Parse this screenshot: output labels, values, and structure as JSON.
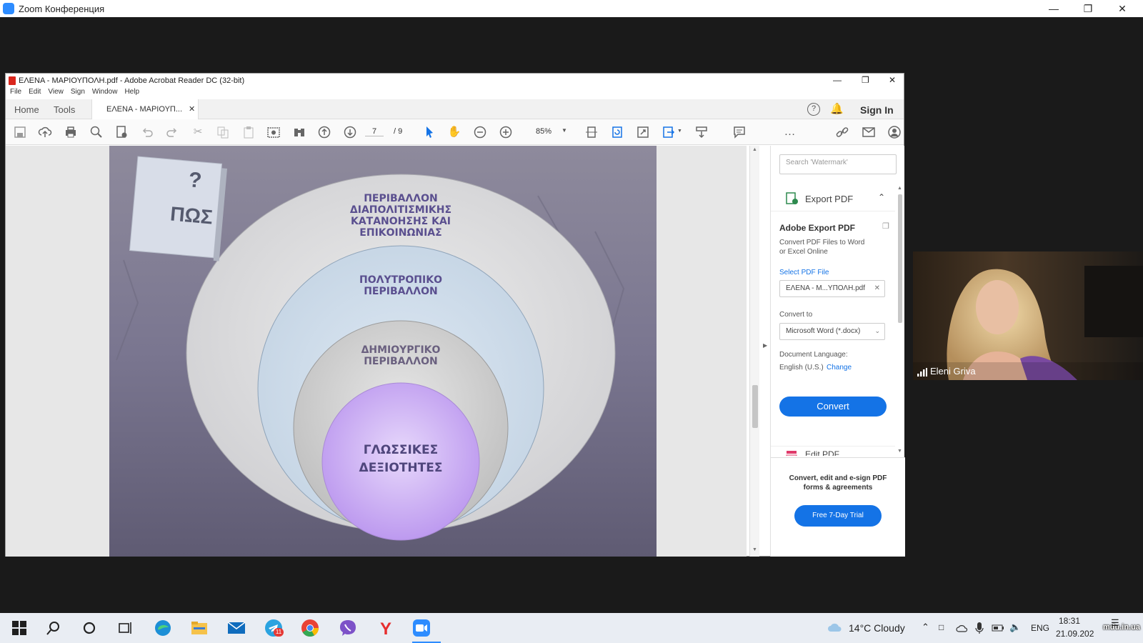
{
  "zoom_window": {
    "title": "Zoom Конференция"
  },
  "acrobat": {
    "title": "ΕΛΕΝΑ - ΜΑΡΙΟΥΠΟΛΗ.pdf - Adobe Acrobat Reader DC (32-bit)",
    "menu": [
      "File",
      "Edit",
      "View",
      "Sign",
      "Window",
      "Help"
    ],
    "tabs": {
      "home": "Home",
      "tools": "Tools",
      "document": "ΕΛΕΝΑ - ΜΑΡΙΟΥΠ..."
    },
    "sign_in": "Sign In",
    "page_current": "7",
    "page_total": "/ 9",
    "zoom": "85%"
  },
  "slide": {
    "sign_question": "?",
    "sign_word": "ΠΩΣ",
    "ring1": [
      "ΠΕΡΙΒΑΛΛΟΝ",
      "ΔΙΑΠΟΛΙΤΙΣΜΙΚΗΣ",
      "ΚΑΤΑΝΟΗΣΗΣ ΚΑΙ",
      "ΕΠΙΚΟΙΝΩΝΙΑΣ"
    ],
    "ring2": [
      "ΠΟΛΥΤΡΟΠΙΚΟ",
      "ΠΕΡΙΒΑΛΛΟΝ"
    ],
    "ring3": [
      "ΔΗΜΙΟΥΡΓΙΚΟ",
      "ΠΕΡΙΒΑΛΛΟΝ"
    ],
    "core": [
      "ΓΛΩΣΣΙΚΕΣ",
      "ΔΕΞΙΟΤΗΤΕΣ"
    ]
  },
  "right_pane": {
    "search_placeholder": "Search 'Watermark'",
    "export_pdf": "Export PDF",
    "adobe_export_pdf": "Adobe Export PDF",
    "description_1": "Convert PDF Files to Word",
    "description_2": "or Excel Online",
    "select_pdf_file": "Select PDF File",
    "file_name": "ΕΛΕΝΑ - Μ...ΥΠΟΛΗ.pdf",
    "convert_to": "Convert to",
    "format": "Microsoft Word (*.docx)",
    "document_language": "Document Language:",
    "language": "English (U.S.)",
    "change": "Change",
    "convert_button": "Convert",
    "edit_pdf": "Edit PDF",
    "promo_1": "Convert, edit and e-sign PDF",
    "promo_2": "forms & agreements",
    "trial_button": "Free 7-Day Trial"
  },
  "video": {
    "participant": "Eleni Griva"
  },
  "taskbar": {
    "weather": "14°C  Cloudy",
    "language": "ENG",
    "time": "18:31",
    "date": "21.09.202",
    "telegram_badge": "11",
    "watermark": "mdu.in.ua"
  },
  "colors": {
    "acrobat_blue": "#1473e6",
    "slide_bg": "#77748a",
    "core_purple": "#c4a3f0",
    "text_purple": "#5a4f8f"
  }
}
